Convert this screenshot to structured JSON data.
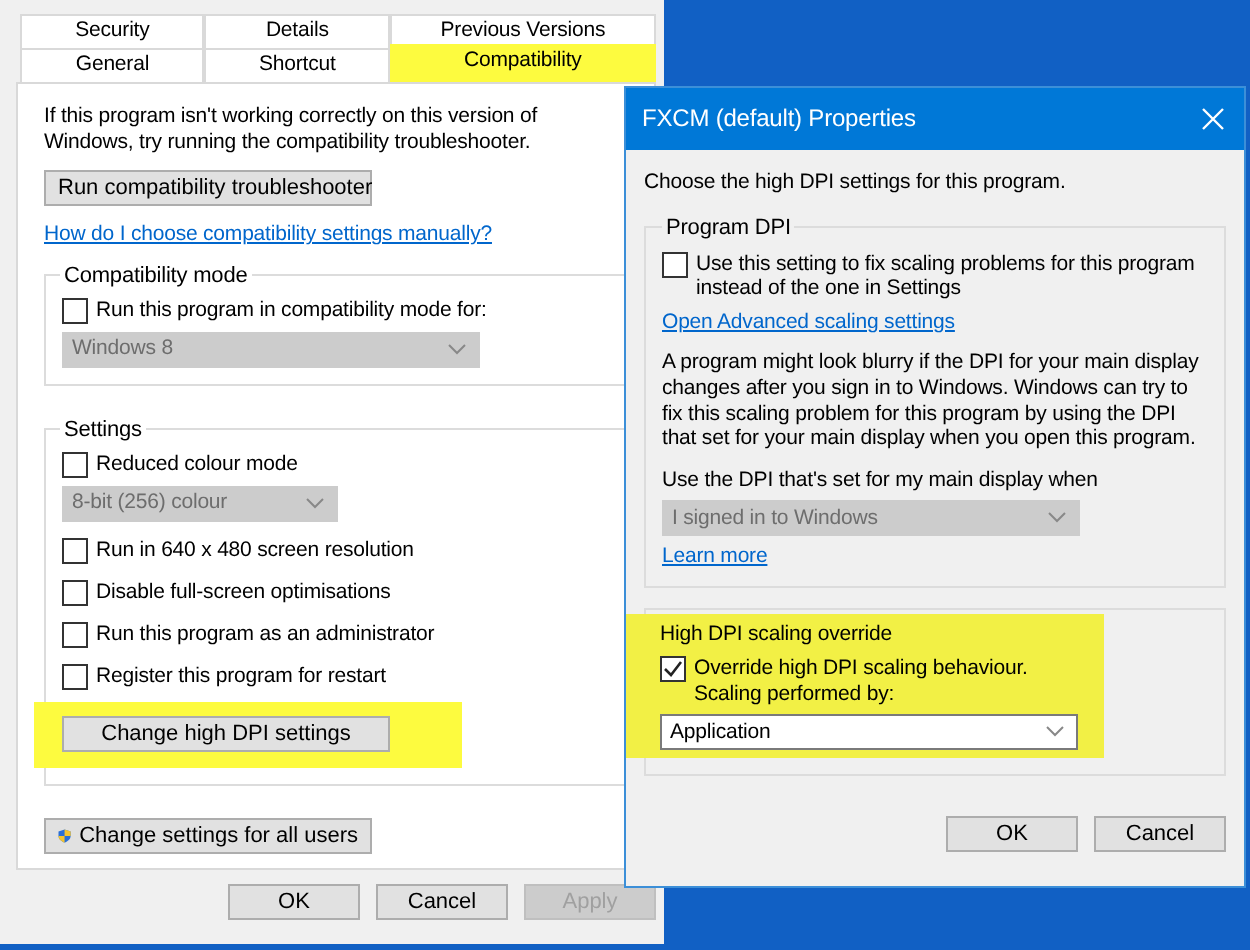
{
  "properties_sheet": {
    "tab_rows": [
      [
        {
          "label": "Security",
          "selected": false,
          "highlighted": false
        },
        {
          "label": "Details",
          "selected": false,
          "highlighted": false
        },
        {
          "label": "Previous Versions",
          "selected": false,
          "highlighted": false
        }
      ],
      [
        {
          "label": "General",
          "selected": false,
          "highlighted": false
        },
        {
          "label": "Shortcut",
          "selected": false,
          "highlighted": false
        },
        {
          "label": "Compatibility",
          "selected": true,
          "highlighted": true
        }
      ]
    ],
    "intro": "If this program isn't working correctly on this version of Windows, try running the compatibility troubleshooter.",
    "troubleshooter_button": "Run compatibility troubleshooter",
    "help_link": "How do I choose compatibility settings manually?",
    "groups": [
      {
        "title": "Compatibility mode",
        "items": [
          {
            "kind": "checkbox",
            "label": "Run this program in compatibility mode for:",
            "checked": false
          },
          {
            "kind": "dropdown",
            "value": "Windows 8",
            "disabled": true
          }
        ]
      },
      {
        "title": "Settings",
        "items": [
          {
            "kind": "checkbox",
            "label": "Reduced colour mode",
            "checked": false
          },
          {
            "kind": "dropdown",
            "value": "8-bit (256) colour",
            "disabled": true
          },
          {
            "kind": "checkbox",
            "label": "Run in 640 x 480 screen resolution",
            "checked": false
          },
          {
            "kind": "checkbox",
            "label": "Disable full-screen optimisations",
            "checked": false
          },
          {
            "kind": "checkbox",
            "label": "Run this program as an administrator",
            "checked": false
          },
          {
            "kind": "checkbox",
            "label": "Register this program for restart",
            "checked": false
          },
          {
            "kind": "button",
            "label": "Change high DPI settings",
            "highlighted": true
          }
        ]
      }
    ],
    "all_users_button": "Change settings for all users",
    "buttons": [
      {
        "label": "OK",
        "disabled": false
      },
      {
        "label": "Cancel",
        "disabled": false
      },
      {
        "label": "Apply",
        "disabled": true
      }
    ]
  },
  "dpi_dialog": {
    "title": "FXCM (default) Properties",
    "intro": "Choose the high DPI settings for this program.",
    "groups": [
      {
        "title": "Program DPI",
        "highlighted": false,
        "items": [
          {
            "kind": "checkbox",
            "label": "Use this setting to fix scaling problems for this program instead of the one in Settings",
            "checked": false
          },
          {
            "kind": "link",
            "label": "Open Advanced scaling settings"
          },
          {
            "kind": "paragraph",
            "label": "A program might look blurry if the DPI for your main display changes after you sign in to Windows. Windows can try to fix this scaling problem for this program by using the DPI that set for your main display when you open this program."
          },
          {
            "kind": "label",
            "label": "Use the DPI that's set for my main display when"
          },
          {
            "kind": "dropdown",
            "value": "I signed in to Windows",
            "disabled": true
          },
          {
            "kind": "link",
            "label": "Learn more"
          }
        ]
      },
      {
        "title": "High DPI scaling override",
        "highlighted": true,
        "items": [
          {
            "kind": "checkbox",
            "label": "Override high DPI scaling behaviour.",
            "checked": true
          },
          {
            "kind": "label",
            "label": "Scaling performed by:"
          },
          {
            "kind": "dropdown",
            "value": "Application",
            "disabled": false
          }
        ]
      }
    ],
    "buttons": [
      {
        "label": "OK",
        "disabled": false
      },
      {
        "label": "Cancel",
        "disabled": false
      }
    ]
  }
}
